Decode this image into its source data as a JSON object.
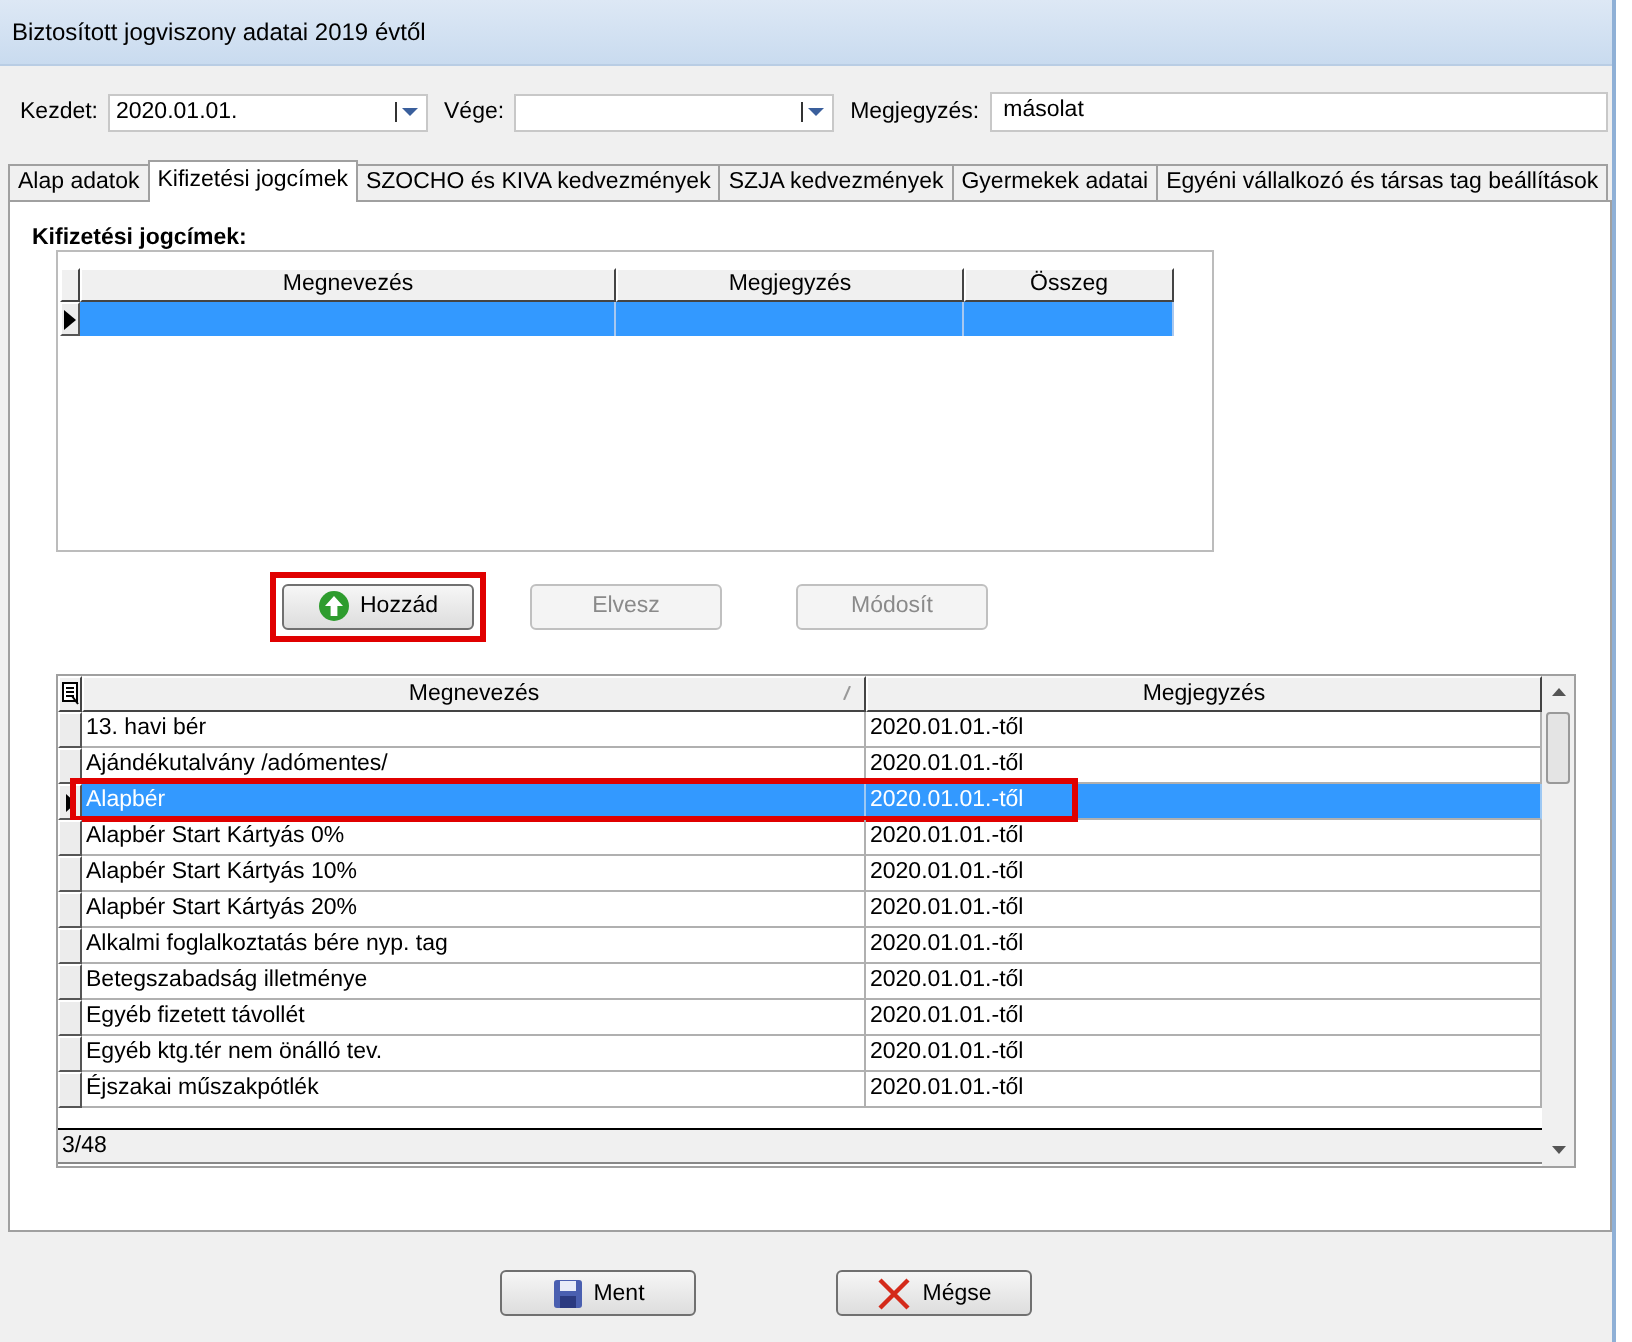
{
  "window": {
    "title": "Biztosított jogviszony adatai 2019 évtől"
  },
  "fields": [
    {
      "label": "Kezdet:",
      "value": "2020.01.01.",
      "kind": "combo"
    },
    {
      "label": "Vége:",
      "kind": "combo"
    },
    {
      "label": "Megjegyzés:",
      "value": "másolat",
      "kind": "text"
    }
  ],
  "tabs": [
    {
      "label": "Alap adatok",
      "selected": false
    },
    {
      "label": "Kifizetési jogcímek",
      "selected": true
    },
    {
      "label": "SZOCHO és KIVA kedvezmények",
      "selected": false
    },
    {
      "label": "SZJA kedvezmények",
      "selected": false
    },
    {
      "label": "Gyermekek adatai",
      "selected": false
    },
    {
      "label": "Egyéni vállalkozó és társas tag beállítások",
      "selected": false
    }
  ],
  "group": {
    "title": "Kifizetési jogcímek:",
    "table": {
      "columns": [
        "Megnevezés",
        "Megjegyzés",
        "Összeg"
      ],
      "rows": [
        {
          "selected": true
        }
      ]
    }
  },
  "actions": [
    {
      "label": "Hozzád",
      "disabled": false,
      "highlighted": true,
      "kind": "add"
    },
    {
      "label": "Elvesz",
      "disabled": true,
      "highlighted": false,
      "kind": "plain"
    },
    {
      "label": "Módosít",
      "disabled": true,
      "highlighted": false,
      "kind": "plain"
    }
  ],
  "list": {
    "columns": [
      {
        "label": "Megnevezés",
        "sorted": true
      },
      {
        "label": "Megjegyzés",
        "sorted": false
      }
    ],
    "rows": [
      {
        "name": "13. havi bér",
        "note": "2020.01.01.-től",
        "selected": false,
        "highlighted": false
      },
      {
        "name": "Ajándékutalvány /adómentes/",
        "note": "2020.01.01.-től",
        "selected": false,
        "highlighted": false
      },
      {
        "name": "Alapbér",
        "note": "2020.01.01.-től",
        "selected": true,
        "highlighted": true
      },
      {
        "name": "Alapbér Start Kártyás 0%",
        "note": "2020.01.01.-től",
        "selected": false,
        "highlighted": false
      },
      {
        "name": "Alapbér Start Kártyás 10%",
        "note": "2020.01.01.-től",
        "selected": false,
        "highlighted": false
      },
      {
        "name": "Alapbér Start Kártyás 20%",
        "note": "2020.01.01.-től",
        "selected": false,
        "highlighted": false
      },
      {
        "name": "Alkalmi foglalkoztatás bére nyp. tag",
        "note": "2020.01.01.-től",
        "selected": false,
        "highlighted": false
      },
      {
        "name": "Betegszabadság illetménye",
        "note": "2020.01.01.-től",
        "selected": false,
        "highlighted": false
      },
      {
        "name": "Egyéb fizetett távollét",
        "note": "2020.01.01.-től",
        "selected": false,
        "highlighted": false
      },
      {
        "name": "Egyéb ktg.tér nem önálló tev.",
        "note": "2020.01.01.-től",
        "selected": false,
        "highlighted": false
      },
      {
        "name": "Éjszakai műszakpótlék",
        "note": "2020.01.01.-től",
        "selected": false,
        "highlighted": false
      }
    ],
    "status": "3/48"
  },
  "footer": [
    {
      "label": "Ment",
      "kind": "save"
    },
    {
      "label": "Mégse",
      "kind": "cancel"
    }
  ]
}
